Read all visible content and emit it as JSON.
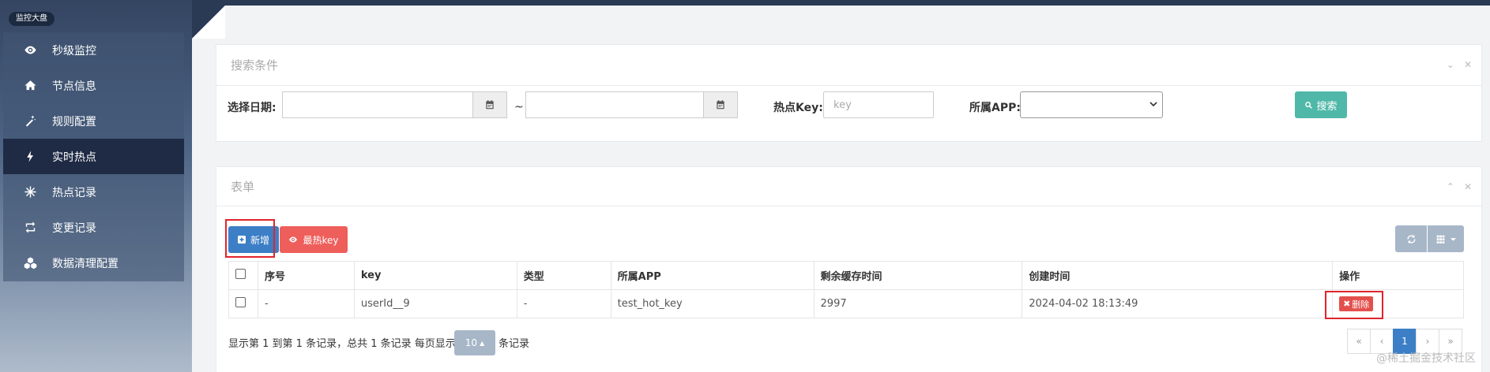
{
  "sidebar": {
    "brand": "监控大盘",
    "items": [
      {
        "label": "秒级监控",
        "icon": "eye-icon"
      },
      {
        "label": "节点信息",
        "icon": "home-icon"
      },
      {
        "label": "规则配置",
        "icon": "magic-wand-icon"
      },
      {
        "label": "实时热点",
        "icon": "lightning-icon",
        "active": true
      },
      {
        "label": "热点记录",
        "icon": "snowflake-icon"
      },
      {
        "label": "变更记录",
        "icon": "retweet-icon"
      },
      {
        "label": "数据清理配置",
        "icon": "cubes-icon"
      }
    ]
  },
  "search_panel": {
    "title": "搜索条件",
    "date_label": "选择日期:",
    "tilde": "~",
    "hotkey_label": "热点Key:",
    "hotkey_placeholder": "key",
    "app_label": "所属APP:",
    "app_value": "",
    "search_button": "搜索"
  },
  "table_panel": {
    "title": "表单",
    "add_button": "新增",
    "hottest_button": "最热key",
    "columns": [
      "序号",
      "key",
      "类型",
      "所属APP",
      "剩余缓存时间",
      "创建时间",
      "操作"
    ],
    "rows": [
      {
        "index": "-",
        "key": "userId__9",
        "type": "-",
        "app": "test_hot_key",
        "ttl": "2997",
        "created": "2024-04-02 18:13:49",
        "action": "删除"
      }
    ],
    "footer_text": "显示第 1 到第 1 条记录，总共 1 条记录 每页显示",
    "page_size": "10",
    "footer_suffix": "条记录",
    "pager": [
      "«",
      "‹",
      "1",
      "›",
      "»"
    ]
  },
  "watermark": "@稀土掘金技术社区",
  "colors": {
    "accent": "#3c7fc6",
    "danger": "#ee5f5b",
    "search": "#50b8a8"
  }
}
